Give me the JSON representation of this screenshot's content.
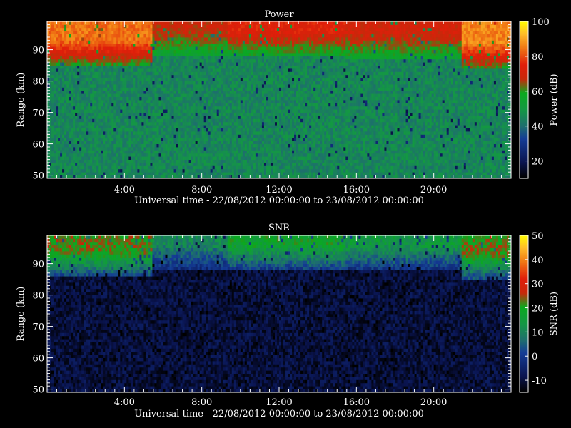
{
  "chart_data": [
    {
      "type": "heatmap",
      "title": "Power",
      "xlabel": "Universal time - 22/08/2012 00:00:00 to 23/08/2012 00:00:00",
      "ylabel": "Range (km)",
      "colorbar_label": "Power (dB)",
      "x_range_hours": [
        0,
        24
      ],
      "x_tick_values_hours": [
        4,
        8,
        12,
        16,
        20
      ],
      "x_tick_labels": [
        "4:00",
        "8:00",
        "12:00",
        "16:00",
        "20:00"
      ],
      "y_range_km": [
        49,
        99
      ],
      "y_tick_values": [
        50,
        60,
        70,
        80,
        90
      ],
      "y_tick_labels": [
        "50",
        "60",
        "70",
        "80",
        "90"
      ],
      "color_range": [
        10,
        100
      ],
      "colorbar_tick_values": [
        20,
        40,
        60,
        80,
        100
      ],
      "colorbar_tick_labels": [
        "20",
        "40",
        "60",
        "80",
        "100"
      ],
      "background_level": 45,
      "layer_summary": [
        {
          "time_hours": [
            0.0,
            5.5
          ],
          "base_km": 85,
          "peak_level": 84
        },
        {
          "time_hours": [
            5.5,
            9.3
          ],
          "base_km": 88,
          "peak_level": 68
        },
        {
          "time_hours": [
            9.3,
            15.5
          ],
          "base_km": 88,
          "peak_level": 74
        },
        {
          "time_hours": [
            15.5,
            21.5
          ],
          "base_km": 87,
          "peak_level": 70
        },
        {
          "time_hours": [
            21.5,
            24.0
          ],
          "base_km": 84,
          "peak_level": 86
        }
      ]
    },
    {
      "type": "heatmap",
      "title": "SNR",
      "xlabel": "Universal time - 22/08/2012 00:00:00 to 23/08/2012 00:00:00",
      "ylabel": "Range (km)",
      "colorbar_label": "SNR (dB)",
      "x_range_hours": [
        0,
        24
      ],
      "x_tick_values_hours": [
        4,
        8,
        12,
        16,
        20
      ],
      "x_tick_labels": [
        "4:00",
        "8:00",
        "12:00",
        "16:00",
        "20:00"
      ],
      "y_range_km": [
        49,
        99
      ],
      "y_tick_values": [
        50,
        60,
        70,
        80,
        90
      ],
      "y_tick_labels": [
        "50",
        "60",
        "70",
        "80",
        "90"
      ],
      "color_range": [
        -15,
        50
      ],
      "colorbar_tick_values": [
        -10,
        0,
        10,
        20,
        30,
        40,
        50
      ],
      "colorbar_tick_labels": [
        "-10",
        "0",
        "10",
        "20",
        "30",
        "40",
        "50"
      ],
      "background_level": -10,
      "layer_summary": [
        {
          "time_hours": [
            0.0,
            5.5
          ],
          "base_km": 86,
          "peak_level": 22
        },
        {
          "time_hours": [
            5.5,
            9.3
          ],
          "base_km": 88,
          "peak_level": 10
        },
        {
          "time_hours": [
            9.3,
            15.5
          ],
          "base_km": 88,
          "peak_level": 18
        },
        {
          "time_hours": [
            15.5,
            21.5
          ],
          "base_km": 88,
          "peak_level": 14
        },
        {
          "time_hours": [
            21.5,
            24.0
          ],
          "base_km": 85,
          "peak_level": 22
        }
      ]
    }
  ]
}
